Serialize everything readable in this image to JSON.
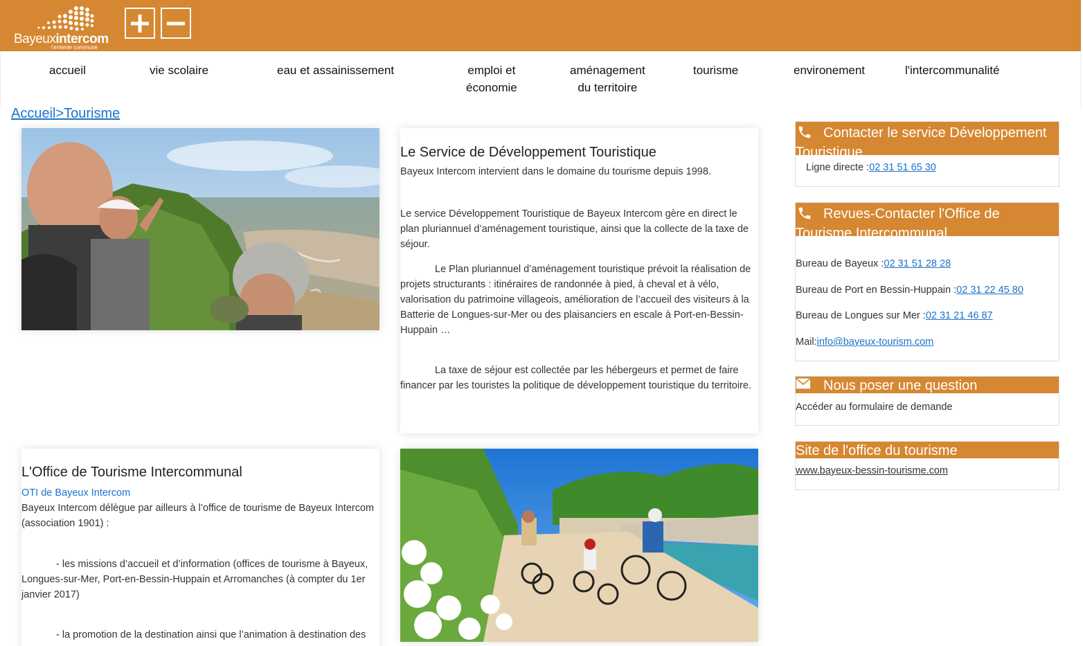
{
  "header": {
    "logo_text_thin": "Bayeux",
    "logo_text_bold": "intercom",
    "logo_tagline": "l'entente commune",
    "zoom_in_icon": "plus-icon",
    "zoom_out_icon": "minus-icon",
    "accent_color": "#d58731"
  },
  "nav": {
    "items": [
      {
        "line1": "accueil",
        "line2": ""
      },
      {
        "line1": "vie scolaire",
        "line2": ""
      },
      {
        "line1": "eau et assainissement",
        "line2": ""
      },
      {
        "line1": "emploi et",
        "line2": "économie"
      },
      {
        "line1": "aménagement",
        "line2": "du territoire"
      },
      {
        "line1": "tourisme",
        "line2": ""
      },
      {
        "line1": "environement",
        "line2": ""
      },
      {
        "line1": "l'intercommunalité",
        "line2": ""
      }
    ]
  },
  "breadcrumb": "Accueil>Tourisme",
  "service": {
    "title": "Le Service de Développement Touristique",
    "p1": "Bayeux Intercom intervient dans le domaine du tourisme depuis 1998.",
    "p2": "Le service Développement Touristique de Bayeux Intercom gère en direct le plan pluriannuel d’aménagement touristique, ainsi que la collecte de la taxe de séjour.",
    "p3": "Le Plan pluriannuel d’aménagement touristique prévoit la réalisation de projets structurants : itinéraires de randonnée à pied, à cheval et à vélo, valorisation du patrimoine villageois, amélioration de l’accueil des visiteurs à la Batterie de Longues-sur-Mer ou des plaisanciers en escale à Port-en-Bessin-Huppain …",
    "p4": "La taxe de séjour est collectée par les hébergeurs et permet de faire financer par les touristes la politique de développement touristique du territoire."
  },
  "office": {
    "title": "L'Office de Tourisme Intercommunal",
    "link": "OTI de Bayeux Intercom",
    "p1": "Bayeux Intercom délègue par ailleurs à l’office de tourisme de Bayeux Intercom (association 1901) :",
    "p2": "- les missions d’accueil et d’information (offices de tourisme à Bayeux, Longues-sur-Mer, Port-en-Bessin-Huppain et Arromanches (à compter du 1er janvier 2017)",
    "p3": "- la promotion de la destination ainsi que l’animation à destination des"
  },
  "sidebar": {
    "contact_service": {
      "title": "Contacter le service Développement Touristique",
      "icon": "phone-icon",
      "line_label": "Ligne directe :",
      "line_phone": "02 31 51 65 30"
    },
    "contact_office": {
      "title": "Revues-Contacter l'Office de Tourisme Intercommunal",
      "icon": "phone-icon",
      "bayeux_label": "Bureau de Bayeux :",
      "bayeux_phone": "02 31 51 28 28",
      "port_label": "Bureau de Port en Bessin-Huppain :",
      "port_phone": "02 31 22 45 80",
      "longues_label": "Bureau de Longues sur Mer :",
      "longues_phone": "02 31 21 46 87",
      "mail_label": "Mail:",
      "mail": "info@bayeux-tourism.com"
    },
    "question": {
      "title": "Nous poser une question",
      "icon": "envelope-icon",
      "text": "Accéder au formulaire de demande"
    },
    "site": {
      "title": "Site de l'office du tourisme",
      "url": "www.bayeux-bessin-tourisme.com"
    }
  }
}
